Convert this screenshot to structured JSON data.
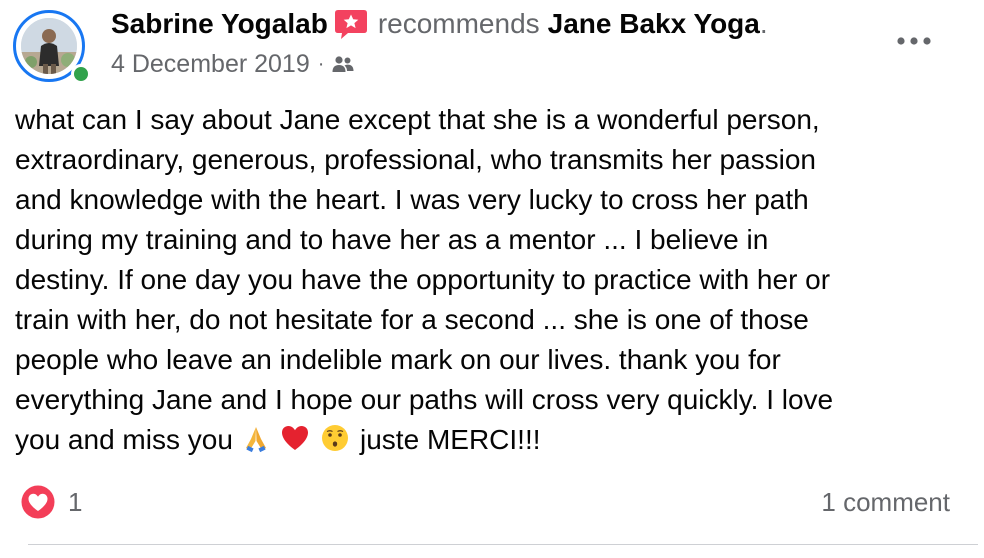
{
  "header": {
    "author_name": "Sabrine Yogalab",
    "recommends_text": "recommends",
    "page_name": "Jane Bakx Yoga",
    "period": ".",
    "date": "4 December 2019",
    "separator": "·",
    "audience_icon": "friends-icon",
    "recommend_icon": "recommendation-star-icon",
    "more_icon": "more-options-icon"
  },
  "post": {
    "lines": [
      "what can I say about Jane except that she is a wonderful person,",
      "extraordinary, generous, professional, who transmits her passion",
      "and knowledge with the heart. I was very lucky to cross her path",
      "during my training and to have her as a mentor ... I believe in",
      "destiny. If one day you have the opportunity to practice with her or",
      "train with her, do not hesitate for a second ... she is one of those",
      "people who leave an indelible mark on our lives. thank you for",
      "everything Jane and I hope our paths will cross very quickly. I love"
    ],
    "last_line_start": "you and miss you",
    "last_line_end": "juste MERCI!!!",
    "emojis": [
      "folded-hands-emoji",
      "red-heart-emoji",
      "kissing-face-emoji"
    ]
  },
  "footer": {
    "reaction_icon": "love-reaction-icon",
    "reaction_count": "1",
    "comments_label": "1 comment"
  },
  "colors": {
    "brand_blue": "#1877f2",
    "online_green": "#31a24c",
    "love_red": "#f33e58",
    "secondary_text": "#65676b",
    "recommend_pink": "#f3425f"
  }
}
